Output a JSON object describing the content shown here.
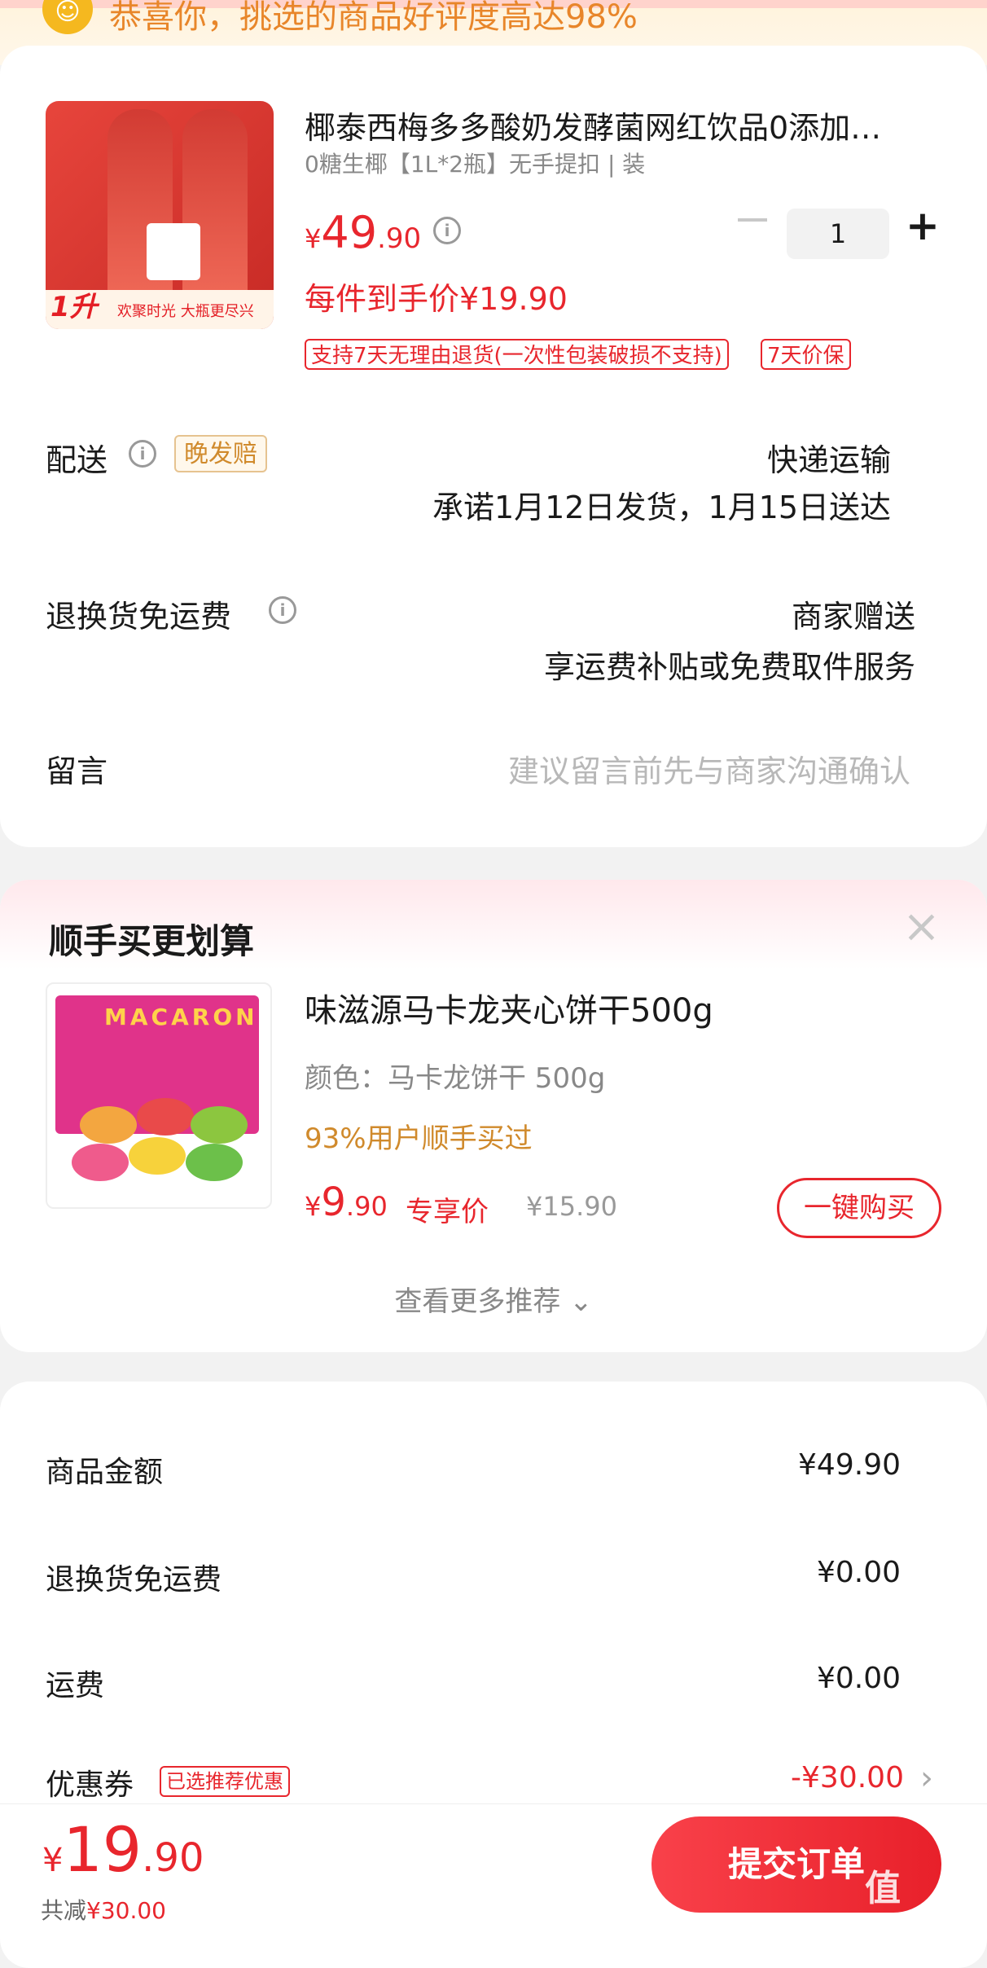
{
  "banner": {
    "text": "恭喜你，挑选的商品好评度高达98%"
  },
  "product": {
    "title": "椰泰西梅多多酸奶发酵菌网红饮品0添加…",
    "spec": "0糖生椰【1L*2瓶】无手提扣 | 装",
    "price_currency": "¥",
    "price_int": "49",
    "price_dec": ".90",
    "quantity": "1",
    "net_price": "每件到手价¥19.90",
    "tags": [
      "支持7天无理由退货(一次性包装破损不支持)",
      "7天价保"
    ],
    "image_text": {
      "liter": "1升",
      "slogan": "欢聚时光 大瓶更尽兴"
    }
  },
  "delivery": {
    "label": "配送",
    "badge": "晚发赔",
    "method": "快递运输",
    "promise": "承诺1月12日发货，1月15日送达"
  },
  "return_shipping": {
    "label": "退换货免运费",
    "value": "商家赠送",
    "desc": "享运费补贴或免费取件服务"
  },
  "message": {
    "label": "留言",
    "placeholder": "建议留言前先与商家沟通确认"
  },
  "recommend": {
    "title": "顺手买更划算",
    "item": {
      "name": "味滋源马卡龙夹心饼干500g",
      "spec": "颜色：马卡龙饼干 500g",
      "hot": "93%用户顺手买过",
      "price_currency": "¥",
      "price_int": "9",
      "price_dec": ".90",
      "exclusive": "专享价",
      "orig_price": "¥15.90",
      "buy_label": "一键购买",
      "image_text": "MACARON"
    },
    "more_label": "查看更多推荐 ⌄"
  },
  "summary": {
    "items": [
      {
        "label": "商品金额",
        "value": "¥49.90"
      },
      {
        "label": "退换货免运费",
        "value": "¥0.00"
      },
      {
        "label": "运费",
        "value": "¥0.00"
      }
    ],
    "coupon": {
      "label": "优惠券",
      "badge": "已选推荐优惠",
      "value": "-¥30.00"
    }
  },
  "footer": {
    "total_currency": "¥",
    "total_int": "19",
    "total_dec": ".90",
    "saving_label": "共减",
    "saving_value": "¥30.00",
    "submit_label": "提交订单",
    "watermark": "值"
  },
  "colors": {
    "accent": "#e8262d",
    "orange": "#d08a2c",
    "banner": "#fff3dc"
  }
}
